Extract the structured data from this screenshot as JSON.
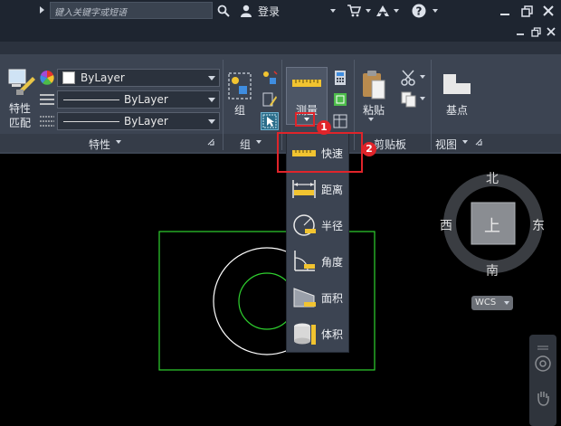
{
  "titlebar": {
    "search_placeholder": "键入关键字或短语",
    "login_label": "登录"
  },
  "ribbon": {
    "properties": {
      "match_label_line1": "特性",
      "match_label_line2": "匹配",
      "color_value": "ByLayer",
      "linetype_value": "ByLayer",
      "lineweight_value": "ByLayer",
      "panel_label": "特性"
    },
    "group": {
      "button_label": "组",
      "panel_label": "组"
    },
    "measure": {
      "button_label": "测量"
    },
    "clipboard": {
      "paste_label": "粘贴",
      "panel_label": "剪贴板"
    },
    "view": {
      "basepoint_label": "基点",
      "panel_label": "视图"
    }
  },
  "measure_menu": {
    "items": [
      {
        "label": "快速",
        "icon": "quick-measure-icon"
      },
      {
        "label": "距离",
        "icon": "distance-icon"
      },
      {
        "label": "半径",
        "icon": "radius-icon"
      },
      {
        "label": "角度",
        "icon": "angle-icon"
      },
      {
        "label": "面积",
        "icon": "area-icon"
      },
      {
        "label": "体积",
        "icon": "volume-icon"
      }
    ]
  },
  "annotations": {
    "badge1": "1",
    "badge2": "2"
  },
  "viewcube": {
    "north": "北",
    "south": "南",
    "east": "东",
    "west": "西",
    "top_face": "上",
    "wcs_label": "WCS"
  },
  "colors": {
    "ribbon_bg": "#3c4452",
    "titlebar_bg": "#1e2530",
    "canvas_bg": "#000000",
    "annotation_red": "#e0242a",
    "drawing_green": "#2fd12f"
  }
}
